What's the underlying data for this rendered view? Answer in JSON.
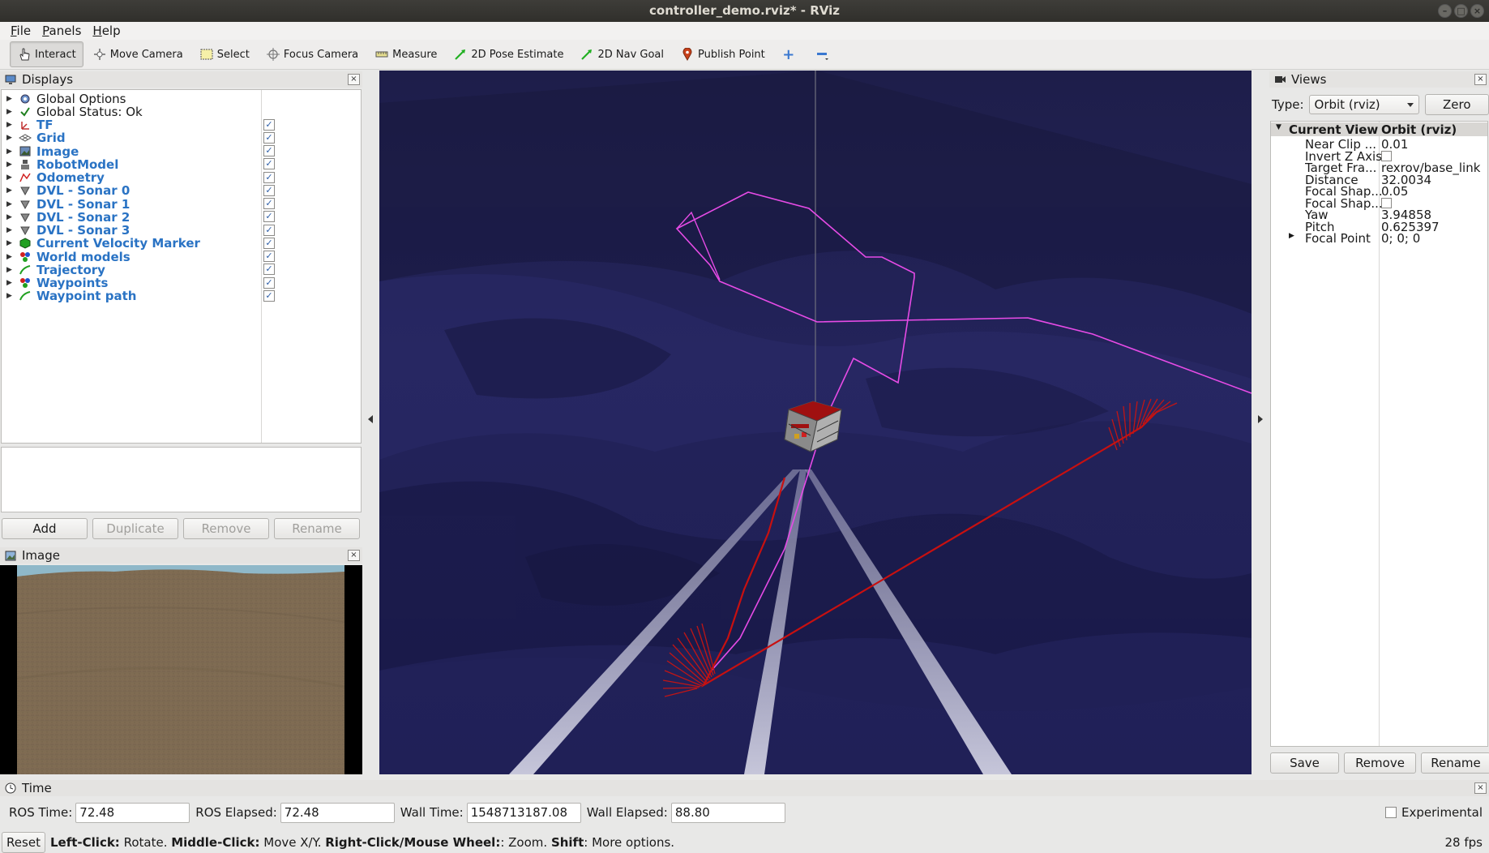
{
  "window": {
    "title": "controller_demo.rviz* - RViz"
  },
  "menu": [
    {
      "label": "File",
      "key": "F",
      "rest": "ile"
    },
    {
      "label": "Panels",
      "key": "P",
      "rest": "anels"
    },
    {
      "label": "Help",
      "key": "H",
      "rest": "elp"
    }
  ],
  "toolbar": {
    "interact": "Interact",
    "move_camera": "Move Camera",
    "select": "Select",
    "focus_camera": "Focus Camera",
    "measure": "Measure",
    "pose_estimate": "2D Pose Estimate",
    "nav_goal": "2D Nav Goal",
    "publish_point": "Publish Point"
  },
  "displays": {
    "title": "Displays",
    "items": [
      {
        "label": "Global Options",
        "icon": "gear-icon",
        "enabled": null,
        "blue": false
      },
      {
        "label": "Global Status: Ok",
        "icon": "check-icon",
        "enabled": null,
        "blue": false
      },
      {
        "label": "TF",
        "icon": "tf-icon",
        "enabled": true,
        "blue": true
      },
      {
        "label": "Grid",
        "icon": "grid-icon",
        "enabled": true,
        "blue": true
      },
      {
        "label": "Image",
        "icon": "image-icon",
        "enabled": true,
        "blue": true
      },
      {
        "label": "RobotModel",
        "icon": "robot-icon",
        "enabled": true,
        "blue": true
      },
      {
        "label": "Odometry",
        "icon": "odometry-icon",
        "enabled": true,
        "blue": true
      },
      {
        "label": "DVL - Sonar 0",
        "icon": "sonar-icon",
        "enabled": true,
        "blue": true
      },
      {
        "label": "DVL - Sonar 1",
        "icon": "sonar-icon",
        "enabled": true,
        "blue": true
      },
      {
        "label": "DVL - Sonar 2",
        "icon": "sonar-icon",
        "enabled": true,
        "blue": true
      },
      {
        "label": "DVL - Sonar 3",
        "icon": "sonar-icon",
        "enabled": true,
        "blue": true
      },
      {
        "label": "Current Velocity Marker",
        "icon": "marker-icon",
        "enabled": true,
        "blue": true
      },
      {
        "label": "World models",
        "icon": "markerarray-icon",
        "enabled": true,
        "blue": true
      },
      {
        "label": "Trajectory",
        "icon": "path-icon",
        "enabled": true,
        "blue": true
      },
      {
        "label": "Waypoints",
        "icon": "markerarray-icon",
        "enabled": true,
        "blue": true
      },
      {
        "label": "Waypoint path",
        "icon": "path-icon",
        "enabled": true,
        "blue": true
      }
    ],
    "buttons": {
      "add": "Add",
      "duplicate": "Duplicate",
      "remove": "Remove",
      "rename": "Rename"
    }
  },
  "image_panel": {
    "title": "Image"
  },
  "views": {
    "title": "Views",
    "type_label": "Type:",
    "type_value": "Orbit (rviz)",
    "zero": "Zero",
    "current_view": {
      "key": "Current View",
      "value": "Orbit (rviz)"
    },
    "props": [
      {
        "key": "Near Clip ...",
        "value": "0.01",
        "check": false
      },
      {
        "key": "Invert Z Axis",
        "value": "",
        "check": true
      },
      {
        "key": "Target Fra...",
        "value": "rexrov/base_link",
        "check": false
      },
      {
        "key": "Distance",
        "value": "32.0034",
        "check": false
      },
      {
        "key": "Focal Shap...",
        "value": "0.05",
        "check": false
      },
      {
        "key": "Focal Shap...",
        "value": "",
        "check": true
      },
      {
        "key": "Yaw",
        "value": "3.94858",
        "check": false
      },
      {
        "key": "Pitch",
        "value": "0.625397",
        "check": false
      },
      {
        "key": "Focal Point",
        "value": "0; 0; 0",
        "check": false
      }
    ],
    "buttons": {
      "save": "Save",
      "remove": "Remove",
      "rename": "Rename"
    }
  },
  "time": {
    "title": "Time",
    "ros_time_label": "ROS Time:",
    "ros_time": "72.48",
    "ros_elapsed_label": "ROS Elapsed:",
    "ros_elapsed": "72.48",
    "wall_time_label": "Wall Time:",
    "wall_time": "1548713187.08",
    "wall_elapsed_label": "Wall Elapsed:",
    "wall_elapsed": "88.80",
    "experimental": "Experimental"
  },
  "status": {
    "reset": "Reset",
    "b1": "Left-Click:",
    "t1": " Rotate. ",
    "b2": "Middle-Click:",
    "t2": " Move X/Y. ",
    "b3": "Right-Click/Mouse Wheel:",
    "t3": ": Zoom. ",
    "b4": "Shift",
    "t4": ": More options.",
    "fps": "28 fps"
  },
  "colors": {
    "path": "#e64be6",
    "trajectory": "#d01010",
    "background": "#1d1d48",
    "link": "#2a73c4"
  }
}
